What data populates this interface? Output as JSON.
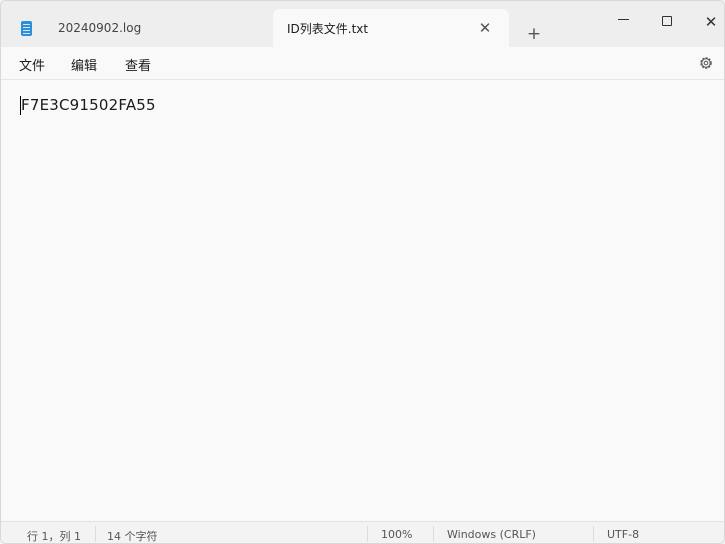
{
  "tabs": [
    {
      "label": "20240902.log",
      "active": false
    },
    {
      "label": "ID列表文件.txt",
      "active": true
    }
  ],
  "tab_close_glyph": "✕",
  "new_tab_glyph": "+",
  "window_controls": {
    "close_glyph": "✕"
  },
  "menu": {
    "file": "文件",
    "edit": "编辑",
    "view": "查看"
  },
  "editor": {
    "content": "F7E3C91502FA55"
  },
  "status": {
    "position": "行 1，列 1",
    "char_count": "14 个字符",
    "zoom": "100%",
    "line_ending": "Windows (CRLF)",
    "encoding": "UTF-8"
  },
  "icons": {
    "file_tab": "document-icon",
    "settings": "gear-icon"
  },
  "colors": {
    "accent": "#2e8fd8"
  }
}
